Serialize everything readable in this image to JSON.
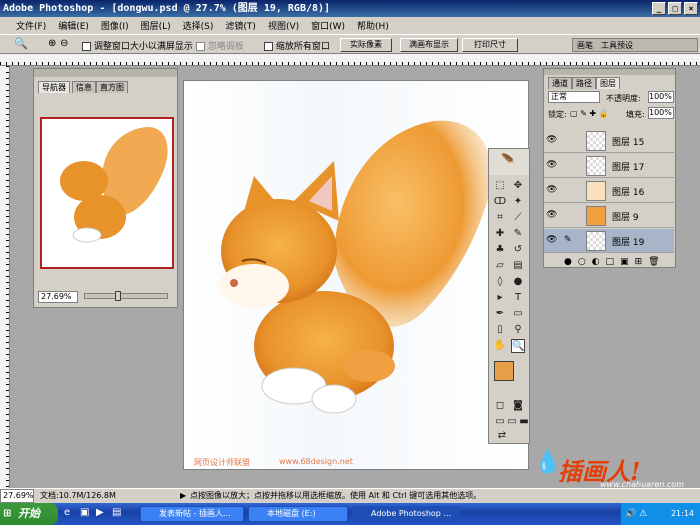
{
  "window": {
    "title": "Adobe Photoshop - [dongwu.psd @ 27.7% (图层 19, RGB/8)]",
    "min_label": "_",
    "max_label": "□",
    "close_label": "×"
  },
  "menu": [
    "文件(F)",
    "编辑(E)",
    "图像(I)",
    "图层(L)",
    "选择(S)",
    "滤镜(T)",
    "视图(V)",
    "窗口(W)",
    "帮助(H)"
  ],
  "options": {
    "resize_window_label": "调整窗口大小以满屏显示",
    "ignore_palettes_label": "忽略调板",
    "zoom_all_label": "缩放所有窗口",
    "actual_pixels": "实际像素",
    "fit_screen": "满画布显示",
    "print_size": "打印尺寸",
    "well_tabs": [
      "画笔",
      "工具预设"
    ]
  },
  "navigator": {
    "tabs": [
      "导航器",
      "信息",
      "直方图"
    ],
    "zoom": "27.69%"
  },
  "layers": {
    "tabs": [
      "通道",
      "路径",
      "图层"
    ],
    "blend_mode": "正常",
    "opacity_label": "不透明度:",
    "opacity": "100%",
    "lock_label": "锁定:",
    "fill_label": "填充:",
    "fill": "100%",
    "items": [
      {
        "name": "图层 15"
      },
      {
        "name": "图层 17"
      },
      {
        "name": "图层 16"
      },
      {
        "name": "图层 9"
      },
      {
        "name": "图层 19",
        "selected": true
      }
    ]
  },
  "canvas": {
    "watermark_left": "网页设计师联盟",
    "watermark_right": "www.68design.net"
  },
  "status": {
    "zoom": "27.69%",
    "doc": "文档:10.7M/126.8M",
    "hint": "点按图像以放大；点按并拖移以用选框缩放。使用 Alt 和 Ctrl 键可选用其他选项。"
  },
  "branding": {
    "logo_text": "插画人!",
    "site": "www.chahuaren.com"
  },
  "taskbar": {
    "start": "开始",
    "tasks": [
      "发表新帖 - 插画人...",
      "本地磁盘 (E:)",
      "Adobe Photoshop ..."
    ],
    "clock": "21:14"
  },
  "colors": {
    "accent_orange": "#e8922a",
    "title_blue": "#0a246a",
    "taskbar_blue": "#2456c8"
  }
}
